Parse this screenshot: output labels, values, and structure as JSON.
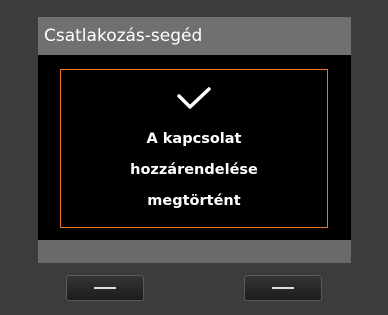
{
  "screen": {
    "title": "Csatlakozás-segéd"
  },
  "dialog": {
    "icon": "checkmark-icon",
    "message_lines": [
      "A kapcsolat",
      "hozzárendelése",
      "megtörtént"
    ],
    "accent_color": "#e8792c"
  },
  "softkeys": {
    "left_icon": "dash-icon",
    "right_icon": "dash-icon"
  }
}
